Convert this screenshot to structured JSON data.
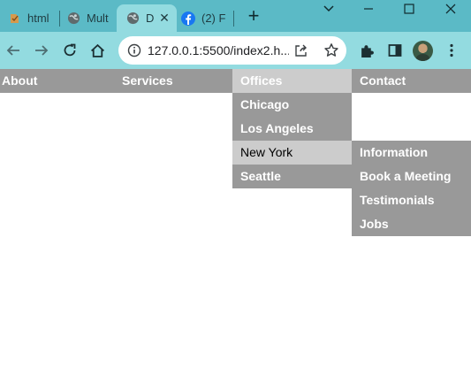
{
  "tabs": [
    {
      "title": "html",
      "icon": "html-file-icon"
    },
    {
      "title": "Mult",
      "icon": "globe-icon"
    },
    {
      "title": "D",
      "icon": "globe-icon",
      "active": true
    },
    {
      "title": "(2) F",
      "icon": "facebook-icon"
    }
  ],
  "window_controls": [
    "chevron-down-icon",
    "minimize-icon",
    "maximize-icon",
    "close-icon"
  ],
  "address_bar": {
    "url": "127.0.0.1:5500/index2.h..."
  },
  "menu": {
    "top": [
      {
        "label": "About"
      },
      {
        "label": "Services"
      },
      {
        "label": "Offices",
        "highlighted": true
      },
      {
        "label": "Contact"
      }
    ],
    "offices_dropdown": [
      {
        "label": "Chicago"
      },
      {
        "label": "Los Angeles"
      },
      {
        "label": "New York",
        "highlighted": true
      },
      {
        "label": "Seattle"
      }
    ],
    "new_york_submenu": [
      {
        "label": "Information"
      },
      {
        "label": "Book a Meeting"
      },
      {
        "label": "Testimonials"
      },
      {
        "label": "Jobs"
      }
    ]
  },
  "colors": {
    "tabstrip": "#5bbac6",
    "toolbar": "#93dbe0",
    "menu_bg": "#999999",
    "menu_highlight": "#cccccc",
    "menu_text": "#ffffff"
  }
}
